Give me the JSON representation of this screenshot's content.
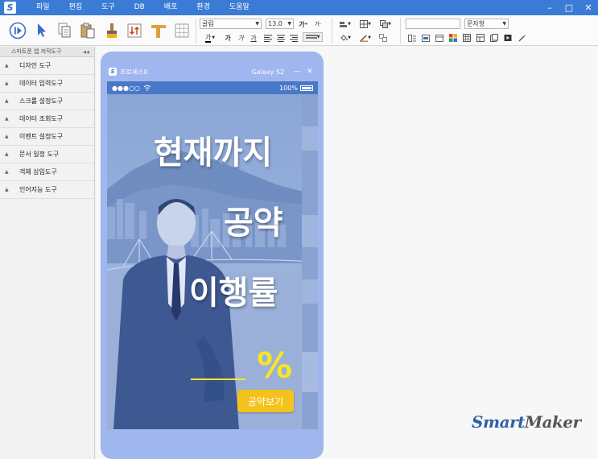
{
  "menubar": {
    "logo": "S",
    "items": [
      "파일",
      "편집",
      "도구",
      "DB",
      "배포",
      "환경",
      "도움말"
    ],
    "controls": [
      "–",
      "□",
      "✕"
    ]
  },
  "toolbar": {
    "font_name": "굴림",
    "font_size": "13.0",
    "grow_font": "가",
    "shrink_font": "가",
    "bold": "가",
    "italic": "가",
    "underline": "가",
    "strike": "가",
    "text_style": "문자형",
    "text_input_value": ""
  },
  "leftpanel": {
    "header": "스마트폰 앱 저작도구",
    "collapse": "◂◂",
    "items": [
      "디자인 도구",
      "데이터 입력도구",
      "스크롤 설정도구",
      "데이터 조회도구",
      "이벤트 설정도구",
      "문서 일정 도구",
      "객체 삽입도구",
      "인어지능 도구"
    ]
  },
  "phone": {
    "title": "프로세스0",
    "model": "Galaxy S2",
    "min": "—",
    "close": "✕",
    "status_signal": "●●●○○",
    "status_battery": "100%",
    "screen": {
      "line1": "현재까지",
      "line2": "공약",
      "line3": "이행률",
      "percent_sign": "%",
      "button": "공약보기"
    }
  },
  "watermark": {
    "main": "Smart",
    "sub": "Maker"
  },
  "colors": {
    "titlebar": "#3a7bd5",
    "phone_frame": "#9fb6ee",
    "accent_yellow": "#f7e627",
    "button_yellow": "#f4c21c"
  }
}
